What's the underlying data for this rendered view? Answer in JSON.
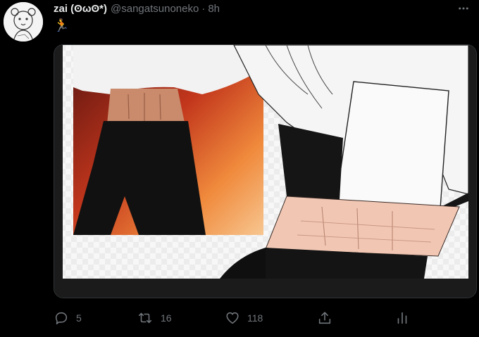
{
  "tweet": {
    "author_name": "zai (ʘωʘ*)",
    "author_handle": "@sangatsunoneko",
    "separator": "·",
    "time": "8h",
    "text": "🏃"
  },
  "actions": {
    "replies": "5",
    "retweets": "16",
    "likes": "118"
  },
  "icons": {
    "more": "more-dots-icon",
    "reply": "reply-icon",
    "retweet": "retweet-icon",
    "like": "heart-icon",
    "share": "share-icon",
    "analytics": "analytics-icon"
  },
  "colors": {
    "background": "#000000",
    "primary_text": "#e7e9ea",
    "secondary_text": "#71767b"
  }
}
